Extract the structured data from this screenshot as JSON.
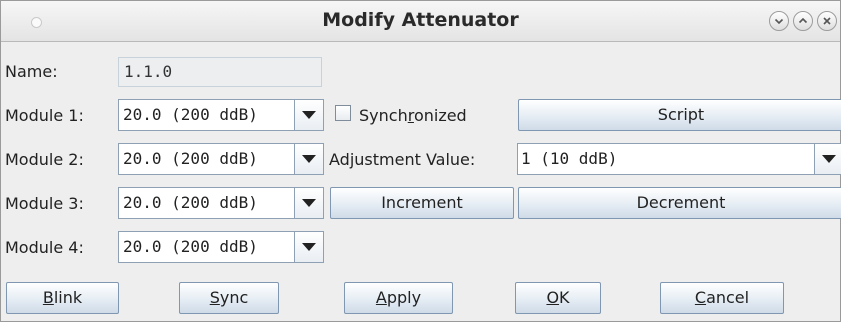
{
  "window": {
    "title": "Modify Attenuator"
  },
  "titlebar_buttons": {
    "minimize_icon": "chevron-down-icon",
    "maximize_icon": "chevron-up-icon",
    "close_icon": "close-icon"
  },
  "form": {
    "name_label": "Name:",
    "name_value": "1.1.0",
    "modules": [
      {
        "label": "Module 1:",
        "value": "20.0 (200 ddB)"
      },
      {
        "label": "Module 2:",
        "value": "20.0 (200 ddB)"
      },
      {
        "label": "Module 3:",
        "value": "20.0 (200 ddB)"
      },
      {
        "label": "Module 4:",
        "value": "20.0 (200 ddB)"
      }
    ],
    "synchronized_label_pre": "Synch",
    "synchronized_label_mnemonic": "r",
    "synchronized_label_post": "onized",
    "synchronized_checked": false,
    "adjustment_label": "Adjustment Value:",
    "adjustment_value": "1 (10 ddB)"
  },
  "buttons": {
    "script": "Script",
    "increment": "Increment",
    "decrement": "Decrement",
    "blink_mnemonic": "B",
    "blink_rest": "link",
    "sync_mnemonic": "S",
    "sync_rest": "ync",
    "apply_mnemonic": "A",
    "apply_rest": "pply",
    "ok_mnemonic": "O",
    "ok_rest": "K",
    "cancel_mnemonic": "C",
    "cancel_rest": "ancel"
  }
}
